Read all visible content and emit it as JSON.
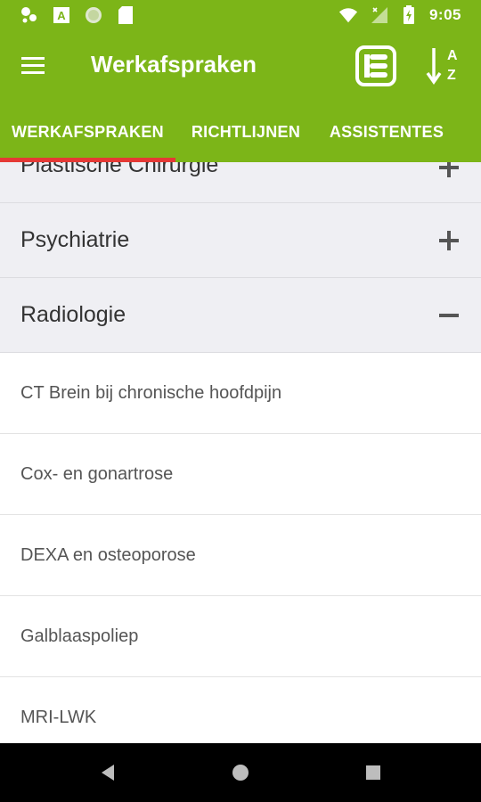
{
  "status": {
    "time": "9:05",
    "left_icons": [
      "notification-icon",
      "a-app-icon",
      "circle-app-icon",
      "sd-card-icon"
    ],
    "right_icons": [
      "wifi-icon",
      "signal-icon",
      "battery-icon"
    ]
  },
  "appbar": {
    "title": "Werkafspraken",
    "sort_top_letter": "A",
    "sort_bottom_letter": "Z"
  },
  "tabs": [
    {
      "label": "WERKAFSPRAKEN",
      "active": true
    },
    {
      "label": "RICHTLIJNEN",
      "active": false
    },
    {
      "label": "ASSISTENTES",
      "active": false
    }
  ],
  "groups": [
    {
      "label": "Plastische Chirurgie",
      "expanded": false
    },
    {
      "label": "Psychiatrie",
      "expanded": false
    },
    {
      "label": "Radiologie",
      "expanded": true
    }
  ],
  "items": [
    {
      "label": "CT Brein bij chronische hoofdpijn"
    },
    {
      "label": "Cox- en gonartrose"
    },
    {
      "label": "DEXA en osteoporose"
    },
    {
      "label": "Galblaaspoliep"
    },
    {
      "label": "MRI-LWK"
    }
  ],
  "colors": {
    "primary": "#7cb518",
    "tab_indicator": "#e53935",
    "group_bg": "#efeff3"
  }
}
